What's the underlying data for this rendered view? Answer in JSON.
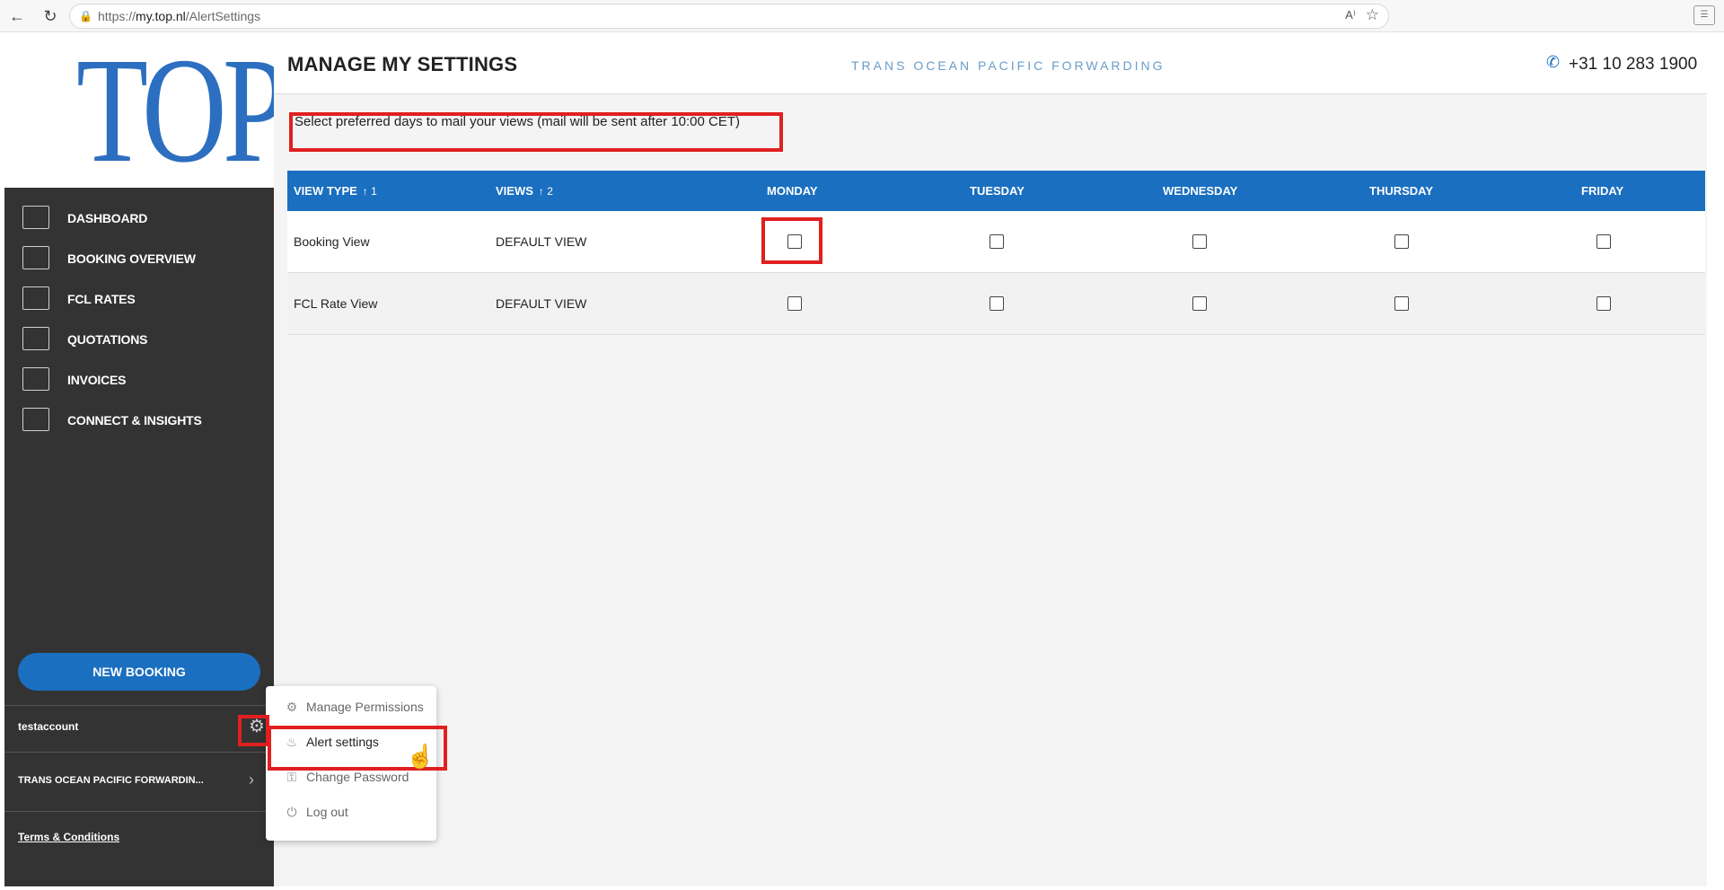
{
  "browser": {
    "url_prefix": "https://",
    "url_host": "my.top.nl",
    "url_path": "/AlertSettings",
    "read_aloud": "A⁾",
    "ext": "☰"
  },
  "sidebar": {
    "logo_text": "TOP",
    "items": [
      {
        "label": "DASHBOARD",
        "icon": "map-icon"
      },
      {
        "label": "BOOKING OVERVIEW",
        "icon": "ship-icon"
      },
      {
        "label": "FCL RATES",
        "icon": "rates-table-icon"
      },
      {
        "label": "QUOTATIONS",
        "icon": "quotation-icon"
      },
      {
        "label": "INVOICES",
        "icon": "invoice-icon"
      },
      {
        "label": "CONNECT & INSIGHTS",
        "icon": "connect-icon"
      }
    ],
    "new_booking_label": "NEW BOOKING",
    "account_name": "testaccount",
    "company_name": "TRANS OCEAN PACIFIC FORWARDIN...",
    "terms_label": "Terms & Conditions"
  },
  "header": {
    "title": "MANAGE MY SETTINGS",
    "tagline": "TRANS OCEAN PACIFIC FORWARDING",
    "phone": "+31 10 283 1900"
  },
  "instructions": "Select preferred days to mail your views (mail will be sent after 10:00 CET)",
  "table": {
    "columns": [
      {
        "label": "VIEW TYPE",
        "sort": "↑ 1"
      },
      {
        "label": "VIEWS",
        "sort": "↑ 2"
      },
      {
        "label": "MONDAY"
      },
      {
        "label": "TUESDAY"
      },
      {
        "label": "WEDNESDAY"
      },
      {
        "label": "THURSDAY"
      },
      {
        "label": "FRIDAY"
      }
    ],
    "rows": [
      {
        "view_type": "Booking View",
        "view": "DEFAULT VIEW",
        "days": [
          false,
          false,
          false,
          false,
          false
        ]
      },
      {
        "view_type": "FCL Rate View",
        "view": "DEFAULT VIEW",
        "days": [
          false,
          false,
          false,
          false,
          false
        ]
      }
    ]
  },
  "popup_menu": {
    "items": [
      {
        "label": "Manage Permissions",
        "icon": "permissions-icon"
      },
      {
        "label": "Alert settings",
        "icon": "bell-icon"
      },
      {
        "label": "Change Password",
        "icon": "key-icon"
      },
      {
        "label": "Log out",
        "icon": "power-icon"
      }
    ]
  },
  "colors": {
    "accent": "#1a6fc0",
    "sidebar": "#333333",
    "highlight": "#e02020"
  }
}
